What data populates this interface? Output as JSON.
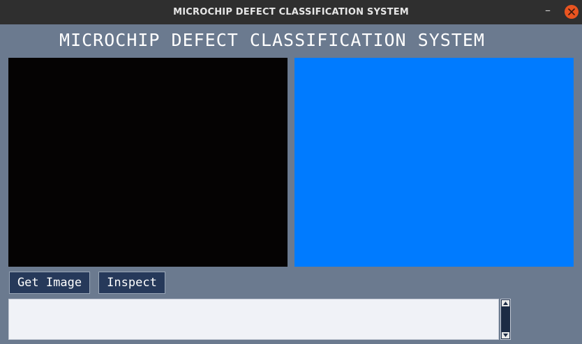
{
  "window": {
    "title": "MICROCHIP DEFECT CLASSIFICATION SYSTEM",
    "minimize_glyph": "–",
    "close_icon": "close-icon"
  },
  "app": {
    "heading": "MICROCHIP DEFECT CLASSIFICATION SYSTEM",
    "panels": {
      "left_color": "#050303",
      "right_color": "#007bff"
    },
    "buttons": {
      "get_image_label": "Get Image",
      "inspect_label": "Inspect"
    },
    "output_text": ""
  },
  "colors": {
    "background": "#6b7a8f",
    "button_bg": "#26395a",
    "titlebar": "#2f2f2f",
    "close_button": "#e95420"
  }
}
